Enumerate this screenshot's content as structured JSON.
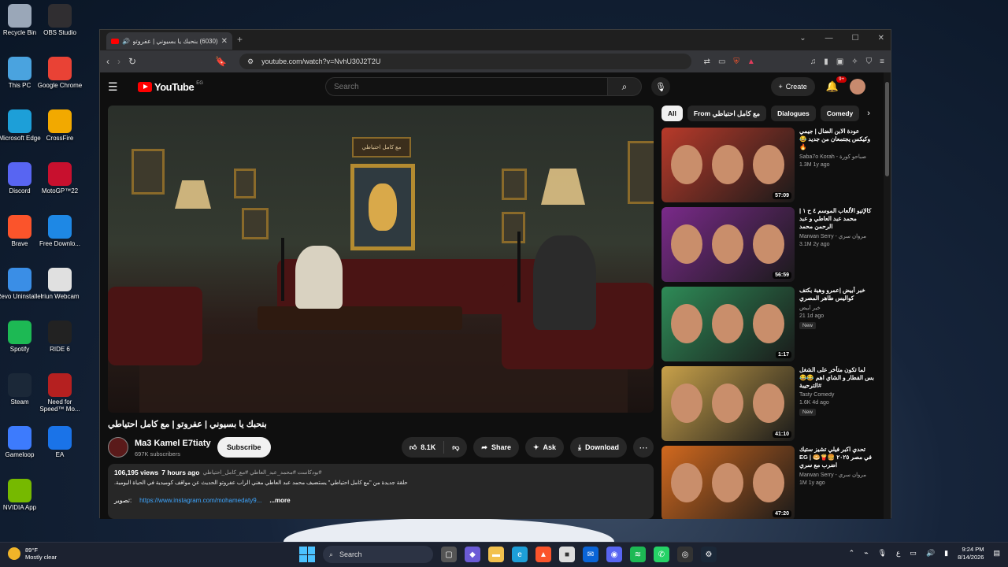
{
  "desktop_icons": [
    {
      "label": "Recycle Bin",
      "icon": "recycle-bin-icon",
      "color": "#9aa7b8"
    },
    {
      "label": "OBS Studio",
      "icon": "obs-icon",
      "color": "#302e31"
    },
    {
      "label": "This PC",
      "icon": "pc-icon",
      "color": "#4aa3df"
    },
    {
      "label": "Google Chrome",
      "icon": "chrome-icon",
      "color": "#e94235"
    },
    {
      "label": "Microsoft Edge",
      "icon": "edge-icon",
      "color": "#1d9fd8"
    },
    {
      "label": "CrossFire",
      "icon": "crossfire-icon",
      "color": "#f2a900"
    },
    {
      "label": "Discord",
      "icon": "discord-icon",
      "color": "#5865f2"
    },
    {
      "label": "MotoGP™22",
      "icon": "motogp-icon",
      "color": "#c8102e"
    },
    {
      "label": "Brave",
      "icon": "brave-icon",
      "color": "#fb542b"
    },
    {
      "label": "Free Downlo...",
      "icon": "free-download-icon",
      "color": "#1e88e5"
    },
    {
      "label": "Revo Uninstaller",
      "icon": "revo-icon",
      "color": "#3a8ee6"
    },
    {
      "label": "Iriun Webcam",
      "icon": "webcam-icon",
      "color": "#e0e0e0"
    },
    {
      "label": "Spotify",
      "icon": "spotify-icon",
      "color": "#1db954"
    },
    {
      "label": "RIDE 6",
      "icon": "ride6-icon",
      "color": "#222222"
    },
    {
      "label": "Steam",
      "icon": "steam-icon",
      "color": "#1b2838"
    },
    {
      "label": "Need for Speed™ Mo...",
      "icon": "nfs-icon",
      "color": "#b52020"
    },
    {
      "label": "Gameloop",
      "icon": "gameloop-icon",
      "color": "#3d7bfd"
    },
    {
      "label": "EA",
      "icon": "ea-icon",
      "color": "#1a73e8"
    },
    {
      "label": "NVIDIA App",
      "icon": "nvidia-icon",
      "color": "#76b900"
    }
  ],
  "browser": {
    "tab_title": "(6030) بنحبك يا بسيوني | عفروتو",
    "url": "youtube.com/watch?v=NvhU30J2T2U"
  },
  "youtube": {
    "logo_text": "YouTube",
    "country": "EG",
    "search_placeholder": "Search",
    "create_label": "Create",
    "notif_count": "9+",
    "video_title": "بنحبك يا بسيوني | عفروتو | مع كامل احتياطي",
    "sign_text": "مع كامل احتياطي",
    "channel_name": "Ma3 Kamel E7tiaty",
    "subscribers": "697K subscribers",
    "subscribe_label": "Subscribe",
    "likes": "8.1K",
    "share_label": "Share",
    "ask_label": "Ask",
    "download_label": "Download",
    "views": "106,195 views",
    "age": "7 hours ago",
    "hashtags": "#بودكاست #محمد_عبد_العاطي #مع_كامل_احتياطي",
    "description": "حلقة جديدة من \"مع كامل احتياطي\" يستضيف محمد عبد العاطي مغني الراب عفروتو الحديث عن مواقف كوميدية في الحياة اليومية.",
    "link_prefix": "تصوير:",
    "link_text": "https://www.instagram.com/mohamedaty9...",
    "more_label": "...more",
    "chips": [
      "All",
      "From مع كامل احتياطي",
      "Dialogues",
      "Comedy"
    ],
    "recommendations": [
      {
        "title": "عودة الابن الضال | جيمي وكيكس يجتمعان من جديد 😂🔥",
        "channel": "Saba7o Korah - صباحو كورة",
        "views": "1.3M",
        "age": "1y ago",
        "duration": "57:09",
        "is_new": "",
        "thumb_color": "#b83a2a"
      },
      {
        "title": "كالإتيو الألعاب الموسم ٤ ح ١ | محمد عبد العاطي و عبد الرحمن محمد",
        "channel": "Marwan Serry - مروان سري",
        "views": "3.1M",
        "age": "2y ago",
        "duration": "56:59",
        "is_new": "",
        "thumb_color": "#7a2a8a"
      },
      {
        "title": "خبر أبيض |عمرو وهبة بكتف كواليس طاهر المصري",
        "channel": "خبر أبيض",
        "views": "21",
        "age": "1d ago",
        "duration": "1:17",
        "is_new": "New",
        "thumb_color": "#2e8b57"
      },
      {
        "title": "لما تكون متأخر على الشغل بس الفطار و الشاي اهم 😂😂 #الترحيبة",
        "channel": "Tasty Comedy",
        "views": "1.6K",
        "age": "4d ago",
        "duration": "41:10",
        "is_new": "New",
        "thumb_color": "#c8a14a"
      },
      {
        "title": "تحدي اكبر فيلي تشيز ستيك في مصر ٢٠٢٥ 🍔🍟🥯 | EG اضرب مع سري",
        "channel": "Marwan Serry - مروان سري",
        "views": "1M",
        "age": "1y ago",
        "duration": "47:20",
        "is_new": "",
        "thumb_color": "#d2691e"
      }
    ]
  },
  "taskbar": {
    "temperature": "89°F",
    "weather": "Mostly clear",
    "search_label": "Search",
    "time": "9:24 PM",
    "date": "8/14/2026",
    "lang": "ع"
  }
}
